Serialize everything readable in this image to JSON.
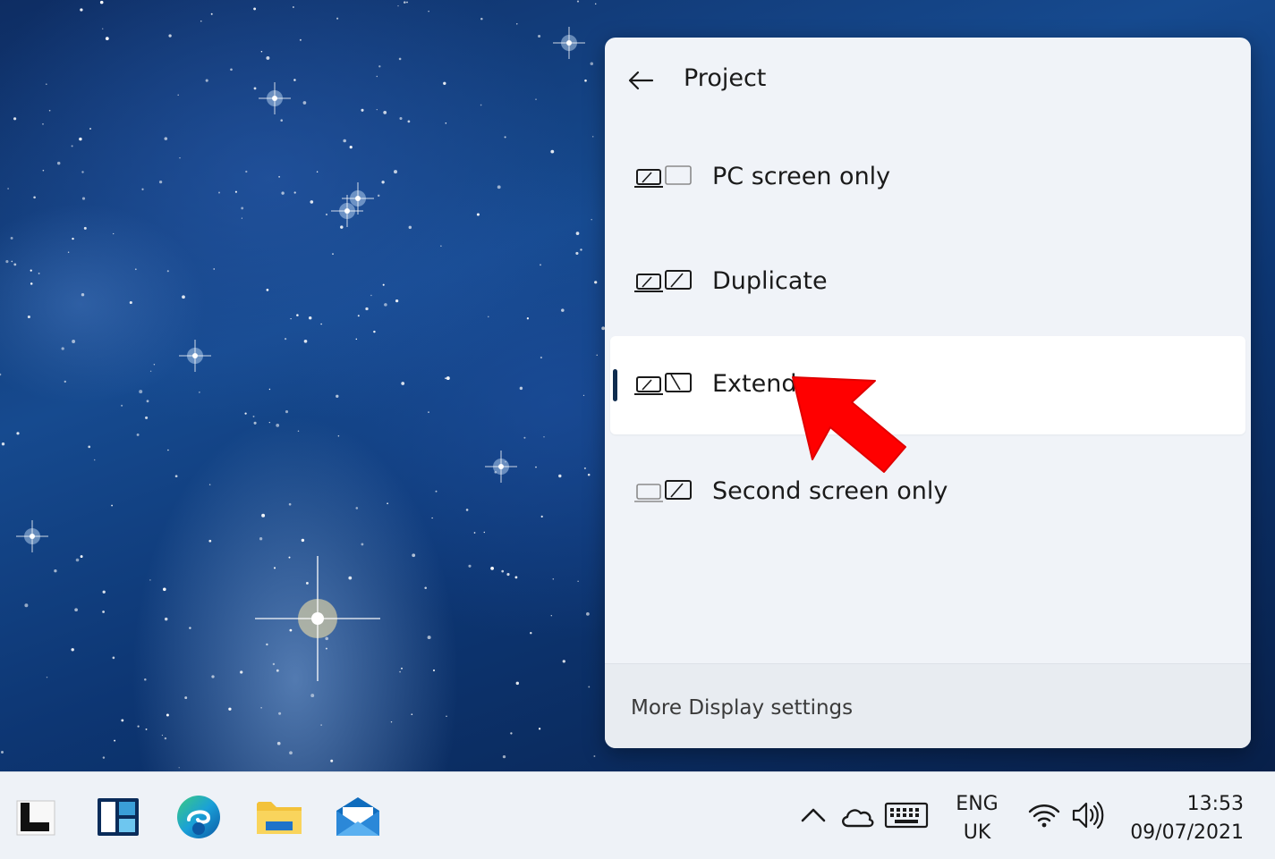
{
  "project_panel": {
    "title": "Project",
    "back_icon": "back-arrow-icon",
    "options": [
      {
        "label": "PC screen only",
        "icon": "pc-screen-only-icon",
        "selected": false
      },
      {
        "label": "Duplicate",
        "icon": "duplicate-icon",
        "selected": false
      },
      {
        "label": "Extend",
        "icon": "extend-icon",
        "selected": true
      },
      {
        "label": "Second screen only",
        "icon": "second-screen-only-icon",
        "selected": false
      }
    ],
    "footer_link": "More Display settings"
  },
  "annotation": {
    "type": "arrow",
    "color": "#ff0000",
    "points_to": "Extend"
  },
  "taskbar": {
    "apps": [
      {
        "name": "start-button",
        "icon": "start-icon"
      },
      {
        "name": "widgets-button",
        "icon": "widgets-icon"
      },
      {
        "name": "edge-button",
        "icon": "edge-icon"
      },
      {
        "name": "file-explorer-button",
        "icon": "folder-icon"
      },
      {
        "name": "mail-button",
        "icon": "mail-icon"
      }
    ],
    "tray": {
      "icons": [
        "chevron-up-icon",
        "onedrive-cloud-icon",
        "keyboard-icon",
        "wifi-icon",
        "volume-icon"
      ],
      "language_line1": "ENG",
      "language_line2": "UK",
      "time": "13:53",
      "date": "09/07/2021"
    }
  },
  "colors": {
    "panel_bg": "#f0f3f8",
    "selected_bg": "#ffffff",
    "selection_bar": "#0f2c4e",
    "taskbar_bg": "#eef2f7"
  }
}
